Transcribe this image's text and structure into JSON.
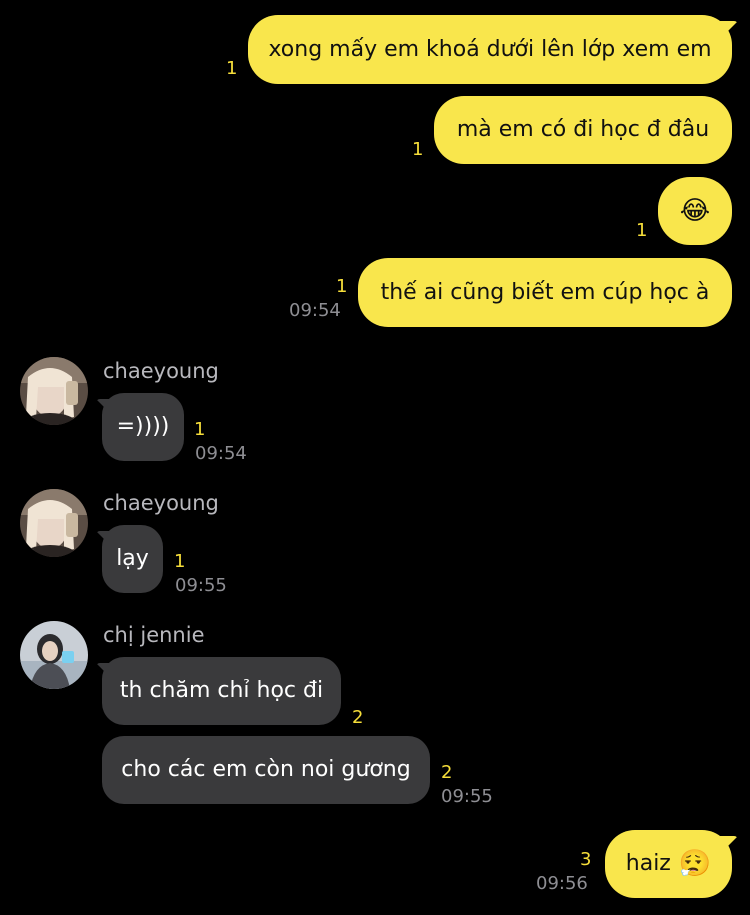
{
  "messages": [
    {
      "text": "xong mấy em khoá dưới lên lớp xem em",
      "unread": "1"
    },
    {
      "text": "mà em có đi học đ đâu",
      "unread": "1"
    },
    {
      "emoji": "😂",
      "unread": "1"
    },
    {
      "text": "thế ai cũng biết em cúp học à",
      "unread": "1",
      "time": "09:54"
    },
    {
      "sender": "chaeyoung",
      "text": "=))))",
      "unread": "1",
      "time": "09:54"
    },
    {
      "sender": "chaeyoung",
      "text": "lạy",
      "unread": "1",
      "time": "09:55"
    },
    {
      "sender": "chị jennie",
      "text": "th chăm chỉ học đi",
      "unread": "2"
    },
    {
      "text": "cho các em còn noi gương",
      "unread": "2",
      "time": "09:55"
    },
    {
      "text": "haiz",
      "emoji": "😮‍💨",
      "unread": "3",
      "time": "09:56"
    }
  ],
  "colors": {
    "background": "#000000",
    "outgoing_bubble": "#f9e64c",
    "incoming_bubble": "#3a3a3c",
    "unread_count": "#f6de3a"
  }
}
